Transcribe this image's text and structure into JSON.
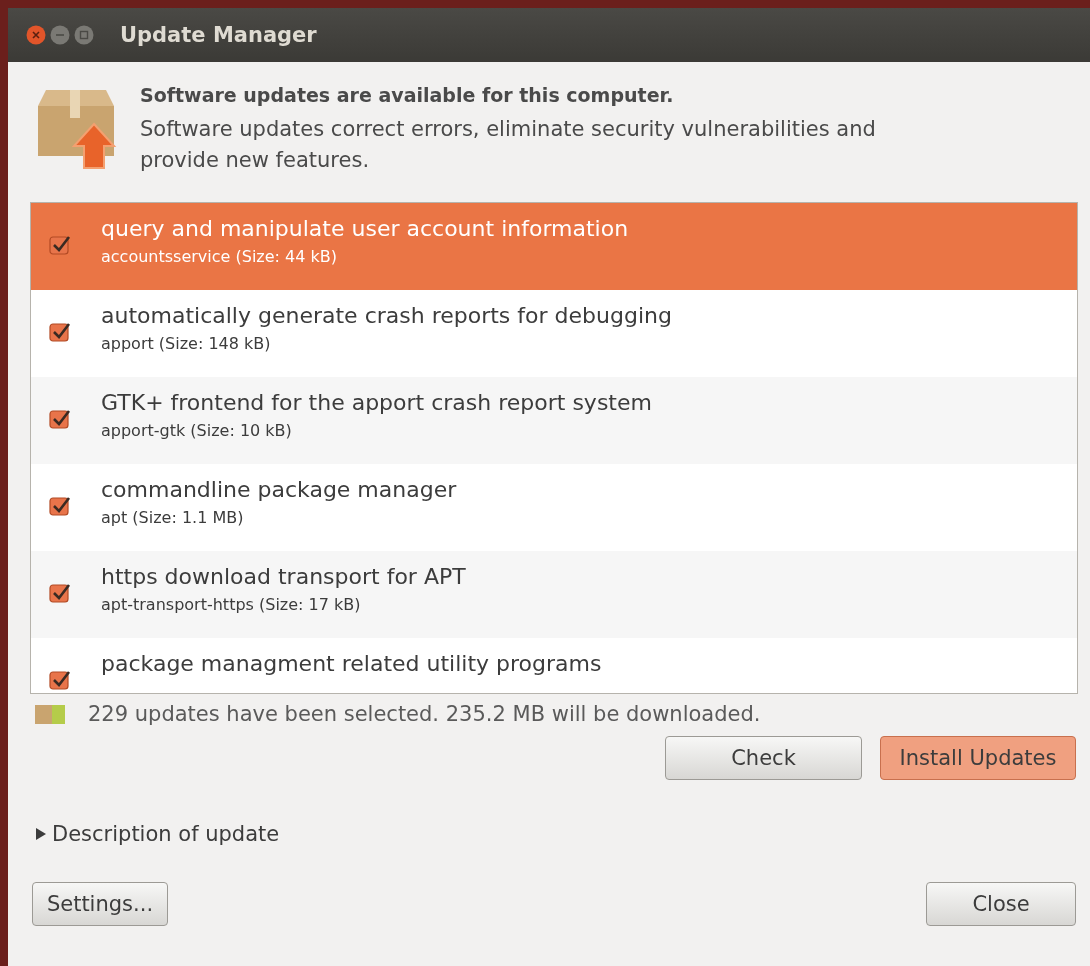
{
  "window": {
    "title": "Update Manager"
  },
  "header": {
    "title": "Software updates are available for this computer.",
    "description": "Software updates correct errors, eliminate security vulnerabilities and provide new features."
  },
  "updates": [
    {
      "summary": "query and manipulate user account information",
      "package": "accountsservice (Size: 44 kB)",
      "checked": true,
      "selected": true
    },
    {
      "summary": "automatically generate crash reports for debugging",
      "package": "apport (Size: 148 kB)",
      "checked": true,
      "selected": false
    },
    {
      "summary": "GTK+ frontend for the apport crash report system",
      "package": "apport-gtk (Size: 10 kB)",
      "checked": true,
      "selected": false
    },
    {
      "summary": "commandline package manager",
      "package": "apt (Size: 1.1 MB)",
      "checked": true,
      "selected": false
    },
    {
      "summary": "https download transport for APT",
      "package": "apt-transport-https (Size: 17 kB)",
      "checked": true,
      "selected": false
    },
    {
      "summary": "package managment related utility programs",
      "checked": true,
      "selected": false
    }
  ],
  "status": "229 updates have been selected. 235.2 MB will be downloaded.",
  "buttons": [
    {
      "label": "Check",
      "kind": "normal"
    },
    {
      "label": "Install Updates",
      "kind": "default"
    }
  ],
  "details": {
    "label": "Description of update",
    "expanded": false
  },
  "footer_buttons": [
    {
      "label": "Settings..."
    },
    {
      "label": "Close"
    }
  ]
}
